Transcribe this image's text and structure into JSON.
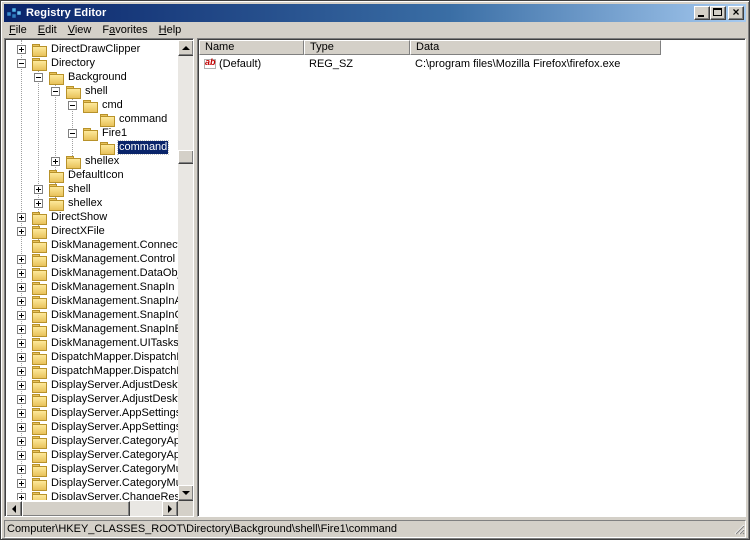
{
  "window": {
    "title": "Registry Editor"
  },
  "menu": [
    {
      "accel": "F",
      "rest": "ile"
    },
    {
      "accel": "E",
      "rest": "dit"
    },
    {
      "accel": "V",
      "rest": "iew"
    },
    {
      "accel": "",
      "pre": "F",
      "u": "a",
      "post": "vorites"
    },
    {
      "accel": "H",
      "rest": "elp"
    }
  ],
  "tree": {
    "items": [
      {
        "label": "DirectDrawClipper",
        "depth": 0,
        "expander": "plus"
      },
      {
        "label": "Directory",
        "depth": 0,
        "expander": "minus"
      },
      {
        "label": "Background",
        "depth": 1,
        "expander": "minus"
      },
      {
        "label": "shell",
        "depth": 2,
        "expander": "minus"
      },
      {
        "label": "cmd",
        "depth": 3,
        "expander": "minus"
      },
      {
        "label": "command",
        "depth": 4,
        "expander": "none"
      },
      {
        "label": "Fire1",
        "depth": 3,
        "expander": "minus"
      },
      {
        "label": "command",
        "depth": 4,
        "expander": "none",
        "selected": true
      },
      {
        "label": "shellex",
        "depth": 2,
        "expander": "plus"
      },
      {
        "label": "DefaultIcon",
        "depth": 1,
        "expander": "none"
      },
      {
        "label": "shell",
        "depth": 1,
        "expander": "plus"
      },
      {
        "label": "shellex",
        "depth": 1,
        "expander": "plus"
      },
      {
        "label": "DirectShow",
        "depth": 0,
        "expander": "plus"
      },
      {
        "label": "DirectXFile",
        "depth": 0,
        "expander": "plus"
      },
      {
        "label": "DiskManagement.Connection",
        "depth": 0,
        "expander": "none"
      },
      {
        "label": "DiskManagement.Control",
        "depth": 0,
        "expander": "plus"
      },
      {
        "label": "DiskManagement.DataObject",
        "depth": 0,
        "expander": "plus"
      },
      {
        "label": "DiskManagement.SnapIn",
        "depth": 0,
        "expander": "plus"
      },
      {
        "label": "DiskManagement.SnapInAbout",
        "depth": 0,
        "expander": "plus"
      },
      {
        "label": "DiskManagement.SnapInCompo",
        "depth": 0,
        "expander": "plus"
      },
      {
        "label": "DiskManagement.SnapInExten",
        "depth": 0,
        "expander": "plus"
      },
      {
        "label": "DiskManagement.UITasks",
        "depth": 0,
        "expander": "plus"
      },
      {
        "label": "DispatchMapper.DispatchMapp",
        "depth": 0,
        "expander": "plus"
      },
      {
        "label": "DispatchMapper.DispatchMapp",
        "depth": 0,
        "expander": "plus"
      },
      {
        "label": "DisplayServer.AdjustDesktopSi",
        "depth": 0,
        "expander": "plus"
      },
      {
        "label": "DisplayServer.AdjustDesktopSi",
        "depth": 0,
        "expander": "plus"
      },
      {
        "label": "DisplayServer.AppSettingsBasi",
        "depth": 0,
        "expander": "plus"
      },
      {
        "label": "DisplayServer.AppSettingsBasi",
        "depth": 0,
        "expander": "plus"
      },
      {
        "label": "DisplayServer.CategoryAppear",
        "depth": 0,
        "expander": "plus"
      },
      {
        "label": "DisplayServer.CategoryAppear",
        "depth": 0,
        "expander": "plus"
      },
      {
        "label": "DisplayServer.CategoryMultiMo",
        "depth": 0,
        "expander": "plus"
      },
      {
        "label": "DisplayServer.CategoryMultiMo",
        "depth": 0,
        "expander": "plus"
      },
      {
        "label": "DisplayServer.ChangeRes",
        "depth": 0,
        "expander": "plus"
      }
    ]
  },
  "list": {
    "columns": [
      "Name",
      "Type",
      "Data"
    ],
    "rows": [
      {
        "name": "(Default)",
        "type": "REG_SZ",
        "data": "C:\\program files\\Mozilla Firefox\\firefox.exe",
        "icon": "string-value-icon"
      }
    ]
  },
  "status": {
    "path": "Computer\\HKEY_CLASSES_ROOT\\Directory\\Background\\shell\\Fire1\\command"
  }
}
